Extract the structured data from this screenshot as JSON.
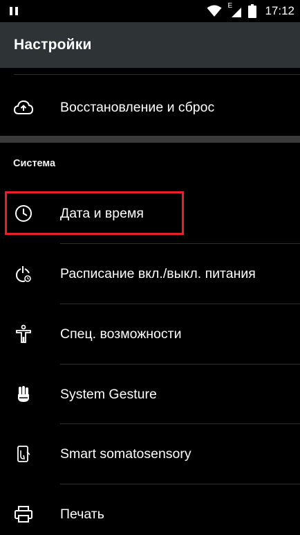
{
  "status_bar": {
    "time": "17:12",
    "network_type": "E",
    "icons": [
      "pause-icon",
      "wifi-icon",
      "signal-icon",
      "battery-icon"
    ]
  },
  "toolbar": {
    "title": "Настройки"
  },
  "section": {
    "header": "Система"
  },
  "items": [
    {
      "label": "Восстановление и сброс",
      "icon": "cloud-upload-icon"
    },
    {
      "label": "Дата и время",
      "icon": "clock-icon",
      "highlighted": true
    },
    {
      "label": "Расписание вкл./выкл. питания",
      "icon": "power-schedule-icon"
    },
    {
      "label": "Спец. возможности",
      "icon": "accessibility-icon"
    },
    {
      "label": "System Gesture",
      "icon": "gesture-hand-icon"
    },
    {
      "label": "Smart somatosensory",
      "icon": "somatosensory-icon"
    },
    {
      "label": "Печать",
      "icon": "printer-icon"
    }
  ],
  "colors": {
    "toolbar_bg": "#2e3436",
    "background": "#000000",
    "highlight": "#e8202a",
    "section_divider": "#3a3a3a"
  }
}
